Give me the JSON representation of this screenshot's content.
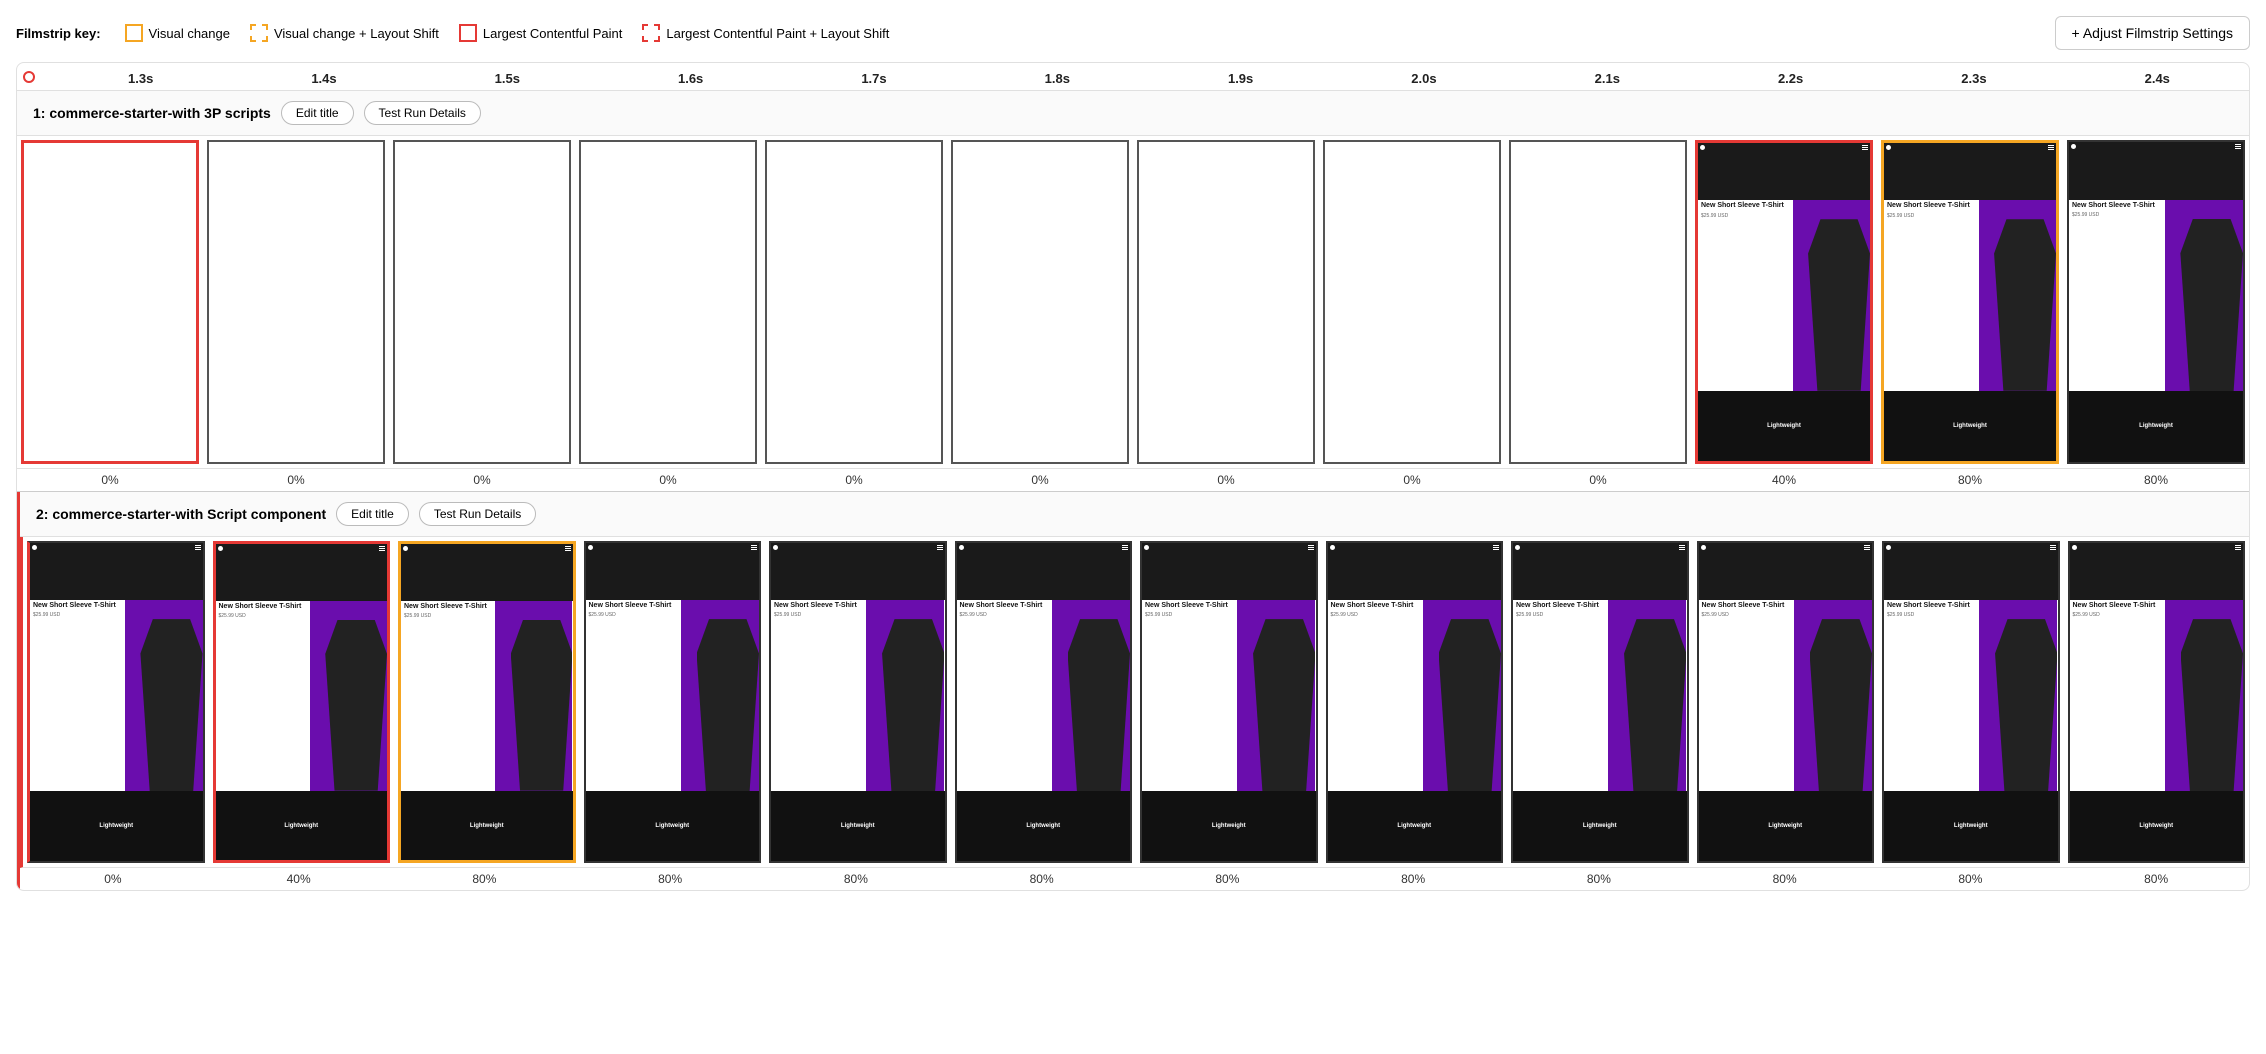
{
  "header": {
    "key_label": "Filmstrip key:",
    "legend": [
      {
        "id": "visual-change",
        "label": "Visual change",
        "style": "yellow-solid"
      },
      {
        "id": "visual-change-layout-shift",
        "label": "Visual change + Layout Shift",
        "style": "yellow-dashed"
      },
      {
        "id": "lcp",
        "label": "Largest Contentful Paint",
        "style": "red-solid"
      },
      {
        "id": "lcp-layout-shift",
        "label": "Largest Contentful Paint + Layout Shift",
        "style": "red-dashed"
      }
    ],
    "adjust_button": "+ Adjust Filmstrip Settings"
  },
  "timeline": {
    "ticks": [
      "1.3s",
      "1.4s",
      "1.5s",
      "1.6s",
      "1.7s",
      "1.8s",
      "1.9s",
      "2.0s",
      "2.1s",
      "2.2s",
      "2.3s",
      "2.4s"
    ]
  },
  "test1": {
    "title": "1: commerce-starter-with 3P scripts",
    "edit_title_label": "Edit title",
    "test_run_label": "Test Run Details",
    "frames": [
      {
        "border": "red-solid",
        "empty": true,
        "percent": "0%"
      },
      {
        "border": "none",
        "empty": true,
        "percent": "0%"
      },
      {
        "border": "none",
        "empty": true,
        "percent": "0%"
      },
      {
        "border": "none",
        "empty": true,
        "percent": "0%"
      },
      {
        "border": "none",
        "empty": true,
        "percent": "0%"
      },
      {
        "border": "none",
        "empty": true,
        "percent": "0%"
      },
      {
        "border": "none",
        "empty": true,
        "percent": "0%"
      },
      {
        "border": "none",
        "empty": true,
        "percent": "0%"
      },
      {
        "border": "none",
        "empty": true,
        "percent": "0%"
      },
      {
        "border": "red-solid",
        "empty": false,
        "percent": "40%"
      },
      {
        "border": "yellow-solid",
        "empty": false,
        "percent": "80%"
      },
      {
        "border": "none",
        "empty": false,
        "percent": "80%"
      }
    ]
  },
  "test2": {
    "title": "2: commerce-starter-with Script component",
    "edit_title_label": "Edit title",
    "test_run_label": "Test Run Details",
    "frames": [
      {
        "border": "none",
        "empty": false,
        "percent": "0%",
        "left_red": true
      },
      {
        "border": "red-solid",
        "empty": false,
        "percent": "40%"
      },
      {
        "border": "yellow-solid",
        "empty": false,
        "percent": "80%"
      },
      {
        "border": "none",
        "empty": false,
        "percent": "80%"
      },
      {
        "border": "none",
        "empty": false,
        "percent": "80%"
      },
      {
        "border": "none",
        "empty": false,
        "percent": "80%"
      },
      {
        "border": "none",
        "empty": false,
        "percent": "80%"
      },
      {
        "border": "none",
        "empty": false,
        "percent": "80%"
      },
      {
        "border": "none",
        "empty": false,
        "percent": "80%"
      },
      {
        "border": "none",
        "empty": false,
        "percent": "80%"
      },
      {
        "border": "none",
        "empty": false,
        "percent": "80%"
      },
      {
        "border": "none",
        "empty": false,
        "percent": "80%"
      }
    ]
  },
  "screenshot": {
    "title": "New Short Sleeve T-Shirt",
    "price": "$25.99 USD",
    "footer": "Lightweight"
  }
}
